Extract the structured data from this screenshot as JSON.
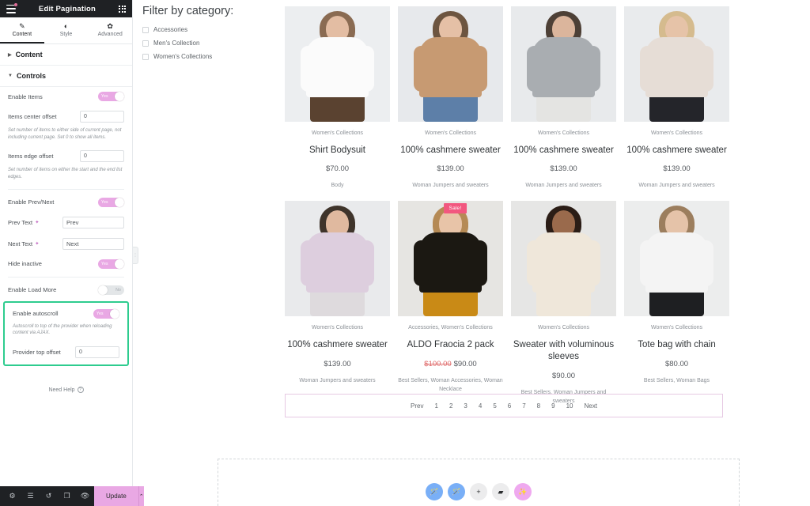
{
  "panel": {
    "title": "Edit Pagination",
    "menu_icon": "hamburger-icon",
    "grid_icon": "apps-grid-icon",
    "tabs": [
      {
        "label": "Content",
        "icon": "pencil-icon",
        "active": true
      },
      {
        "label": "Style",
        "icon": "contrast-icon",
        "active": false
      },
      {
        "label": "Advanced",
        "icon": "gear-icon",
        "active": false
      }
    ],
    "sections": [
      {
        "label": "Content",
        "expanded": false
      },
      {
        "label": "Controls",
        "expanded": true
      }
    ],
    "controls": {
      "enable_items": {
        "label": "Enable Items",
        "value": "Yes",
        "state": "on"
      },
      "items_center_offset": {
        "label": "Items center offset",
        "value": "0"
      },
      "items_center_desc": "Set number of items to either side of current page, not including current page. Set 0 to show all items.",
      "items_edge_offset": {
        "label": "Items edge offset",
        "value": "0"
      },
      "items_edge_desc": "Set number of items on either the start and the end list edges.",
      "enable_prev_next": {
        "label": "Enable Prev/Next",
        "value": "Yes",
        "state": "on"
      },
      "prev_text": {
        "label": "Prev Text",
        "value": "Prev",
        "dynamic_icon": "dynamic-tags-icon"
      },
      "next_text": {
        "label": "Next Text",
        "value": "Next",
        "dynamic_icon": "dynamic-tags-icon"
      },
      "hide_inactive": {
        "label": "Hide inactive",
        "value": "Yes",
        "state": "on"
      },
      "enable_load_more": {
        "label": "Enable Load More",
        "value": "No",
        "state": "off"
      },
      "enable_autoscroll": {
        "label": "Enable autoscroll",
        "value": "Yes",
        "state": "on"
      },
      "autoscroll_desc": "Autoscroll to top of the provider when reloading content via AJAX.",
      "provider_top_offset": {
        "label": "Provider top offset",
        "value": "0"
      }
    },
    "need_help": "Need Help",
    "footer": {
      "icons": [
        "settings-gear-icon",
        "navigator-layers-icon",
        "history-clock-icon",
        "responsive-mode-icon",
        "preview-eye-icon"
      ],
      "update_label": "Update",
      "update_caret": "chevron-up-icon"
    },
    "highlight_color": "#2ecc8f",
    "accent_color": "#e9a8e4"
  },
  "canvas": {
    "filter": {
      "title": "Filter by category:",
      "items": [
        {
          "label": "Accessories",
          "checked": false
        },
        {
          "label": "Men's Collection",
          "checked": false
        },
        {
          "label": "Women's Collections",
          "checked": false
        }
      ]
    },
    "products": [
      {
        "category": "Women's Collections",
        "name": "Shirt Bodysuit",
        "price": "$70.00",
        "old_price": "",
        "tags": "Body",
        "sale": false,
        "img": {
          "wall": "#eceef0",
          "garment": "#fbfbfb",
          "hair": "#8a6b52",
          "skin": "#e3bda3",
          "bottom": "#5a4230"
        }
      },
      {
        "category": "Women's Collections",
        "name": "100% cashmere sweater",
        "price": "$139.00",
        "old_price": "",
        "tags": "Woman Jumpers and sweaters",
        "sale": false,
        "img": {
          "wall": "#e7e9ec",
          "garment": "#c79a72",
          "hair": "#6d5540",
          "skin": "#e5c0a6",
          "bottom": "#5d7fa8"
        }
      },
      {
        "category": "Women's Collections",
        "name": "100% cashmere sweater",
        "price": "$139.00",
        "old_price": "",
        "tags": "Woman Jumpers and sweaters",
        "sale": false,
        "img": {
          "wall": "#e8eaec",
          "garment": "#a9adb1",
          "hair": "#4d4036",
          "skin": "#dbb59c",
          "bottom": "#e4e4e2"
        }
      },
      {
        "category": "Women's Collections",
        "name": "100% cashmere sweater",
        "price": "$139.00",
        "old_price": "",
        "tags": "Woman Jumpers and sweaters",
        "sale": false,
        "img": {
          "wall": "#e9ebed",
          "garment": "#e6ddd6",
          "hair": "#d5bb8e",
          "skin": "#e6c3a8",
          "bottom": "#24252a"
        }
      },
      {
        "category": "Women's Collections",
        "name": "100% cashmere sweater",
        "price": "$139.00",
        "old_price": "",
        "tags": "Woman Jumpers and sweaters",
        "sale": false,
        "img": {
          "wall": "#e9eaec",
          "garment": "#ddcede",
          "hair": "#3f342b",
          "skin": "#e0b99f",
          "bottom": "#dedadd"
        }
      },
      {
        "category": "Accessories, Women's Collections",
        "name": "ALDO Fraocia 2 pack",
        "price": "$90.00",
        "old_price": "$100.00",
        "tags": "Best Sellers, Woman Accessories, Woman Necklace",
        "sale": true,
        "sale_label": "Sale!",
        "img": {
          "wall": "#e6e5e2",
          "garment": "#1b1812",
          "hair": "#b58a55",
          "skin": "#e8c4a8",
          "bottom": "#c98a16"
        }
      },
      {
        "category": "Women's Collections",
        "name": "Sweater with voluminous sleeves",
        "price": "$90.00",
        "old_price": "",
        "tags": "Best Sellers, Woman Jumpers and sweaters",
        "sale": false,
        "img": {
          "wall": "#e6e6e5",
          "garment": "#efe7da",
          "hair": "#2b1d16",
          "skin": "#9a6a4c",
          "bottom": "#efe7da"
        }
      },
      {
        "category": "Women's Collections",
        "name": "Tote bag with chain",
        "price": "$80.00",
        "old_price": "",
        "tags": "Best Sellers, Woman Bags",
        "sale": false,
        "img": {
          "wall": "#eceded",
          "garment": "#f4f4f4",
          "hair": "#9c7e5e",
          "skin": "#e5c3a9",
          "bottom": "#1e1f22"
        }
      }
    ],
    "pagination": {
      "prev": "Prev",
      "pages": [
        "1",
        "2",
        "3",
        "4",
        "5",
        "6",
        "7",
        "8",
        "9",
        "10"
      ],
      "next": "Next",
      "border_color": "#e6c9e3"
    },
    "add_bar": [
      {
        "icon": "magic-wand-icon",
        "style": "blue"
      },
      {
        "icon": "magic-wand-icon",
        "style": "blue"
      },
      {
        "icon": "plus-icon",
        "style": "grey"
      },
      {
        "icon": "folder-icon",
        "style": "grey"
      },
      {
        "icon": "ai-sparkle-icon",
        "style": "pink"
      }
    ]
  }
}
